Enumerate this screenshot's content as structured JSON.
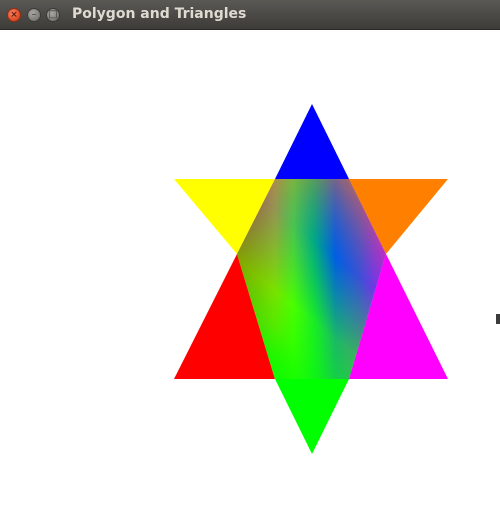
{
  "window": {
    "title": "Polygon and Triangles",
    "buttons": {
      "close_glyph": "×",
      "minimize_glyph": "–",
      "maximize_glyph": "□"
    }
  },
  "colors": {
    "titlebar": "#4a4945",
    "canvas_background": "#ffffff",
    "blue": "#0000ff",
    "yellow": "#ffff00",
    "orange": "#ff8000",
    "red": "#ff0000",
    "magenta": "#ff00ff",
    "green": "#00ff00"
  }
}
